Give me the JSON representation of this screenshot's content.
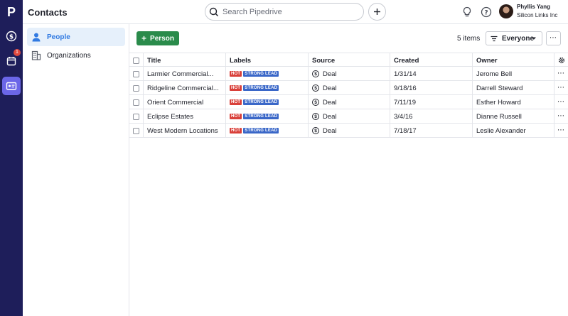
{
  "rail": {
    "logo": "P",
    "notification_count": "1"
  },
  "header": {
    "title": "Contacts",
    "search_placeholder": "Search Pipedrive",
    "user_name": "Phyllis Yang",
    "user_company": "Silicon Links Inc"
  },
  "sidebar": {
    "items": [
      {
        "label": "People",
        "icon": "person-icon"
      },
      {
        "label": "Organizations",
        "icon": "building-icon"
      }
    ]
  },
  "toolbar": {
    "add_label": "Person",
    "items_count": "5 items",
    "filter_label": "Everyone"
  },
  "table": {
    "columns": [
      "Title",
      "Labels",
      "Source",
      "Created",
      "Owner"
    ],
    "tag_hot": "HOT",
    "tag_lead": "STRONG LEAD",
    "rows": [
      {
        "title": "Larmier Commercial...",
        "source": "Deal",
        "created": "1/31/14",
        "owner": "Jerome Bell"
      },
      {
        "title": "Ridgeline Commercial...",
        "source": "Deal",
        "created": "9/18/16",
        "owner": "Darrell Steward"
      },
      {
        "title": "Orient Commercial",
        "source": "Deal",
        "created": "7/11/19",
        "owner": "Esther Howard"
      },
      {
        "title": "Eclipse Estates",
        "source": "Deal",
        "created": "3/4/16",
        "owner": "Dianne Russell"
      },
      {
        "title": "West Modern Locations",
        "source": "Deal",
        "created": "7/18/17",
        "owner": "Leslie Alexander"
      }
    ]
  },
  "colors": {
    "rail_bg": "#1e1e5a",
    "rail_active": "#6b66e8",
    "primary_green": "#2a8b4b",
    "link_blue": "#317ae2",
    "tag_hot": "#d9403a",
    "tag_lead": "#3a67c8"
  }
}
